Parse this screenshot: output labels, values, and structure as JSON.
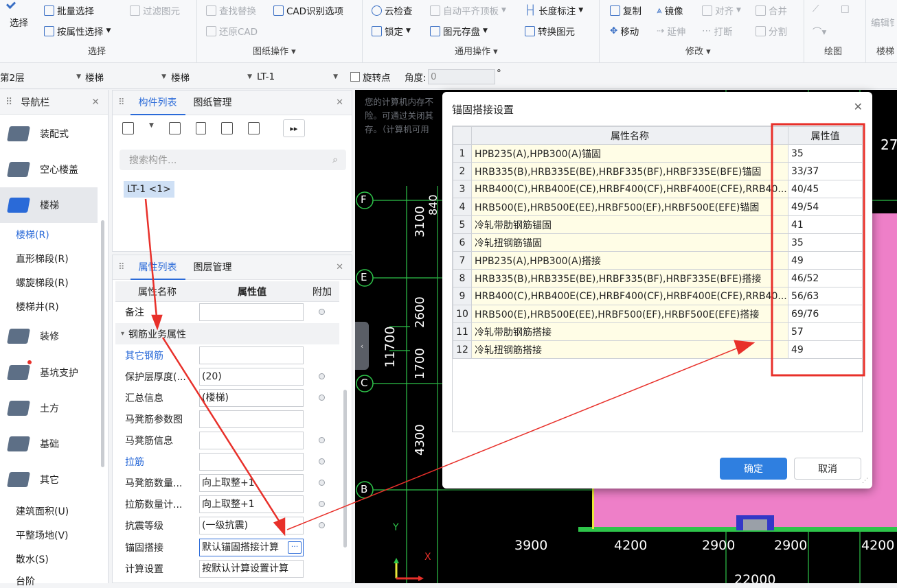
{
  "ribbon": {
    "select_big": "选择",
    "batch_select": "批量选择",
    "filter_element": "过滤图元",
    "attr_select": "按属性选择",
    "select_group": "选择",
    "find_replace": "查找替换",
    "cad_options": "CAD识别选项",
    "restore_cad": "还原CAD",
    "drawing_group": "图纸操作",
    "cloud_check": "云检查",
    "auto_align": "自动平齐顶板",
    "length_mark": "长度标注",
    "lock": "锁定",
    "element_save": "图元存盘",
    "convert_element": "转换图元",
    "general_group": "通用操作",
    "copy": "复制",
    "mirror": "镜像",
    "align": "对齐",
    "merge": "合并",
    "move": "移动",
    "extend": "延伸",
    "break": "打断",
    "split": "分割",
    "modify_group": "修改",
    "draw_group": "绘图",
    "edit_partial": "编辑钅",
    "stair_partial": "楼梯"
  },
  "toolbar2": {
    "floor": "第2层",
    "category": "楼梯",
    "type": "楼梯",
    "name": "LT-1",
    "rotate_label": "旋转点",
    "angle_label": "角度:",
    "angle_value": "0",
    "degree": "°"
  },
  "nav": {
    "title": "导航栏",
    "categories": [
      "装配式",
      "空心楼盖",
      "楼梯",
      "装修",
      "基坑支护",
      "土方",
      "基础",
      "其它"
    ],
    "stair_items": [
      "楼梯(R)",
      "直形梯段(R)",
      "螺旋梯段(R)",
      "楼梯井(R)"
    ],
    "other_items": [
      "建筑面积(U)",
      "平整场地(V)",
      "散水(S)",
      "台阶"
    ]
  },
  "component_panel": {
    "tab_active": "构件列表",
    "tab_other": "图纸管理",
    "search_placeholder": "搜索构件...",
    "item": "LT-1 <1>"
  },
  "property_panel": {
    "tab_active": "属性列表",
    "tab_other": "图层管理",
    "col_name": "属性名称",
    "col_value": "属性值",
    "col_extra": "附加",
    "group": "钢筋业务属性",
    "rows": [
      {
        "name": "备注",
        "value": ""
      },
      {
        "name": "其它钢筋",
        "value": ""
      },
      {
        "name": "保护层厚度(...",
        "value": "(20)"
      },
      {
        "name": "汇总信息",
        "value": "(楼梯)"
      },
      {
        "name": "马凳筋参数图",
        "value": ""
      },
      {
        "name": "马凳筋信息",
        "value": ""
      },
      {
        "name": "拉筋",
        "value": ""
      },
      {
        "name": "马凳筋数量...",
        "value": "向上取整+1"
      },
      {
        "name": "拉筋数量计...",
        "value": "向上取整+1"
      },
      {
        "name": "抗震等级",
        "value": "(一级抗震)"
      },
      {
        "name": "锚固搭接",
        "value": "默认锚固搭接计算"
      },
      {
        "name": "计算设置",
        "value": "按默认计算设置计算"
      }
    ]
  },
  "canvas": {
    "memory_warning": [
      "您的计算机内存不",
      "险。可通过关闭其",
      "存。（计算机可用"
    ],
    "axis_rows": [
      "F",
      "E",
      "C",
      "B"
    ],
    "vertical_dims": [
      "3100",
      "2600",
      "1700",
      "4300",
      "840",
      "11700"
    ],
    "horizontal_dims": [
      "3900",
      "4200",
      "2900",
      "2900",
      "4200"
    ],
    "total_dim": "22000",
    "right_partial": "27",
    "axis_x": "X",
    "axis_y": "Y"
  },
  "dialog": {
    "title": "锚固搭接设置",
    "col_name": "属性名称",
    "col_value": "属性值",
    "rows": [
      {
        "no": "1",
        "name": "HPB235(A),HPB300(A)锚固",
        "value": "35"
      },
      {
        "no": "2",
        "name": "HRB335(B),HRB335E(BE),HRBF335(BF),HRBF335E(BFE)锚固",
        "value": "33/37"
      },
      {
        "no": "3",
        "name": "HRB400(C),HRB400E(CE),HRBF400(CF),HRBF400E(CFE),RRB40...",
        "value": "40/45"
      },
      {
        "no": "4",
        "name": "HRB500(E),HRB500E(EE),HRBF500(EF),HRBF500E(EFE)锚固",
        "value": "49/54"
      },
      {
        "no": "5",
        "name": "冷轧带肋钢筋锚固",
        "value": "41"
      },
      {
        "no": "6",
        "name": "冷轧扭钢筋锚固",
        "value": "35"
      },
      {
        "no": "7",
        "name": "HPB235(A),HPB300(A)搭接",
        "value": "49"
      },
      {
        "no": "8",
        "name": "HRB335(B),HRB335E(BE),HRBF335(BF),HRBF335E(BFE)搭接",
        "value": "46/52"
      },
      {
        "no": "9",
        "name": "HRB400(C),HRB400E(CE),HRBF400(CF),HRBF400E(CFE),RRB40...",
        "value": "56/63"
      },
      {
        "no": "10",
        "name": "HRB500(E),HRB500E(EE),HRBF500(EF),HRBF500E(EFE)搭接",
        "value": "69/76"
      },
      {
        "no": "11",
        "name": "冷轧带肋钢筋搭接",
        "value": "57"
      },
      {
        "no": "12",
        "name": "冷轧扭钢筋搭接",
        "value": "49"
      }
    ],
    "ok": "确定",
    "cancel": "取消"
  },
  "colors": {
    "accent": "#2a6ad8",
    "annotation_red": "#e8302a",
    "canvas_bg": "#000000",
    "grid_green": "#2ec44a",
    "slab_pink": "#ee7fc8",
    "row_yellow": "#fffde6"
  }
}
